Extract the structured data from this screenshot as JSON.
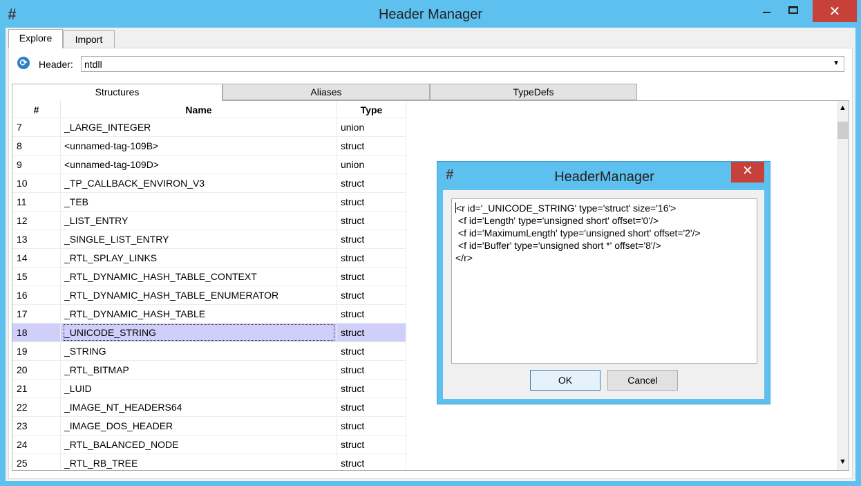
{
  "window": {
    "title": "Header Manager",
    "app_icon": "#",
    "controls": {
      "close": "✕"
    }
  },
  "tabs": [
    "Explore",
    "Import"
  ],
  "header_select": {
    "label": "Header:",
    "value": "ntdll"
  },
  "subtabs": [
    "Structures",
    "Aliases",
    "TypeDefs"
  ],
  "table": {
    "columns": [
      "#",
      "Name",
      "Type"
    ],
    "rows": [
      {
        "num": "7",
        "name": "_LARGE_INTEGER",
        "type": "union"
      },
      {
        "num": "8",
        "name": "<unnamed-tag-109B>",
        "type": "struct"
      },
      {
        "num": "9",
        "name": "<unnamed-tag-109D>",
        "type": "union"
      },
      {
        "num": "10",
        "name": "_TP_CALLBACK_ENVIRON_V3",
        "type": "struct"
      },
      {
        "num": "11",
        "name": "_TEB",
        "type": "struct"
      },
      {
        "num": "12",
        "name": "_LIST_ENTRY",
        "type": "struct"
      },
      {
        "num": "13",
        "name": "_SINGLE_LIST_ENTRY",
        "type": "struct"
      },
      {
        "num": "14",
        "name": "_RTL_SPLAY_LINKS",
        "type": "struct"
      },
      {
        "num": "15",
        "name": "_RTL_DYNAMIC_HASH_TABLE_CONTEXT",
        "type": "struct"
      },
      {
        "num": "16",
        "name": "_RTL_DYNAMIC_HASH_TABLE_ENUMERATOR",
        "type": "struct"
      },
      {
        "num": "17",
        "name": "_RTL_DYNAMIC_HASH_TABLE",
        "type": "struct"
      },
      {
        "num": "18",
        "name": "_UNICODE_STRING",
        "type": "struct"
      },
      {
        "num": "19",
        "name": "_STRING",
        "type": "struct"
      },
      {
        "num": "20",
        "name": "_RTL_BITMAP",
        "type": "struct"
      },
      {
        "num": "21",
        "name": "_LUID",
        "type": "struct"
      },
      {
        "num": "22",
        "name": "_IMAGE_NT_HEADERS64",
        "type": "struct"
      },
      {
        "num": "23",
        "name": "_IMAGE_DOS_HEADER",
        "type": "struct"
      },
      {
        "num": "24",
        "name": "_RTL_BALANCED_NODE",
        "type": "struct"
      },
      {
        "num": "25",
        "name": "_RTL_RB_TREE",
        "type": "struct"
      }
    ],
    "selected_num": "18"
  },
  "dialog": {
    "title": "HeaderManager",
    "close": "✕",
    "lines": [
      "<r id='_UNICODE_STRING' type='struct' size='16'>",
      " <f id='Length' type='unsigned short' offset='0'/>",
      " <f id='MaximumLength' type='unsigned short' offset='2'/>",
      " <f id='Buffer' type='unsigned short *' offset='8'/>",
      "</r>"
    ],
    "ok_label": "OK",
    "cancel_label": "Cancel"
  }
}
